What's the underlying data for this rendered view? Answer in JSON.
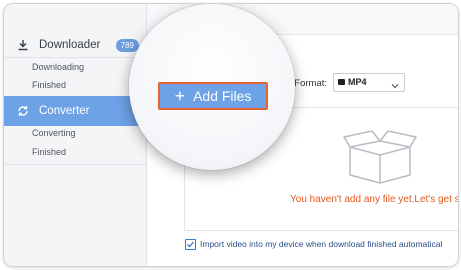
{
  "sidebar": {
    "downloader": {
      "label": "Downloader",
      "badge": "789",
      "icon": "download-icon"
    },
    "downloader_sub": [
      "Downloading",
      "Finished"
    ],
    "converter": {
      "label": "Converter",
      "icon": "convert-icon"
    },
    "converter_sub": [
      "Converting",
      "Finished"
    ]
  },
  "toolbar": {
    "format_label": "t Format:",
    "format_value": "MP4",
    "add_files_label": "Add Files"
  },
  "main": {
    "empty_message": "You haven't add any file yet.Let's get s",
    "import_checkbox_label": "Import video into my device when download finished automatical",
    "import_checked": true
  },
  "colors": {
    "accent": "#6ea2e6",
    "highlight_border": "#e8642c",
    "empty_text": "#e65a20"
  }
}
